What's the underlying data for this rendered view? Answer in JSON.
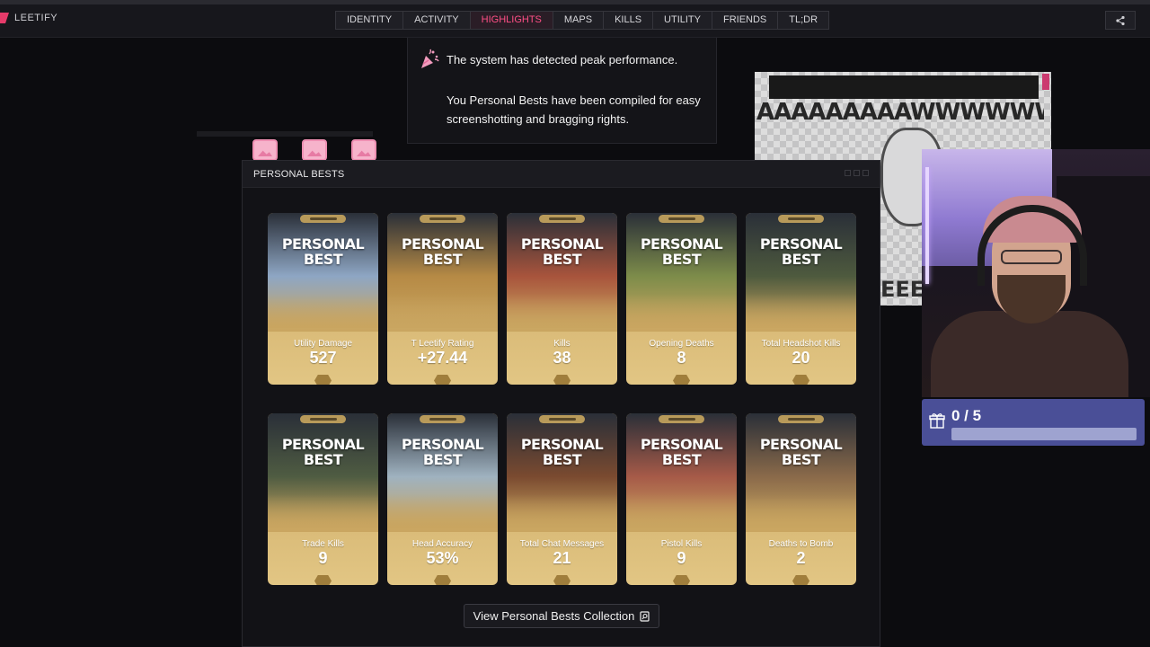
{
  "brand": {
    "name": "LEETIFY",
    "accent": "#e63b6a"
  },
  "nav": {
    "tabs": [
      {
        "label": "IDENTITY",
        "active": false
      },
      {
        "label": "ACTIVITY",
        "active": false
      },
      {
        "label": "HIGHLIGHTS",
        "active": true
      },
      {
        "label": "MAPS",
        "active": false
      },
      {
        "label": "KILLS",
        "active": false
      },
      {
        "label": "UTILITY",
        "active": false
      },
      {
        "label": "FRIENDS",
        "active": false
      },
      {
        "label": "TL;DR",
        "active": false
      }
    ],
    "share_icon": "share-icon"
  },
  "notice": {
    "icon": "party-popper-icon",
    "line1": "The system has detected peak performance.",
    "line2": "You Personal Bests have been compiled for easy screenshotting and bragging rights."
  },
  "overlay": {
    "meme_text": "AAAAAAAAAWWWWWW",
    "meme_bottom": "EEEA",
    "goal_count": "0 / 5",
    "goal_progress": 0
  },
  "panel": {
    "title": "PERSONAL BESTS",
    "card_heading": "PERSONAL\nBEST",
    "cards": [
      {
        "label": "Utility Damage",
        "value": "527",
        "scene": "#8ea6c4"
      },
      {
        "label": "T Leetify Rating",
        "value": "+27.44",
        "scene": "#b68a45"
      },
      {
        "label": "Kills",
        "value": "38",
        "scene": "#a8543c"
      },
      {
        "label": "Opening Deaths",
        "value": "8",
        "scene": "#7d8c4a"
      },
      {
        "label": "Total Headshot Kills",
        "value": "20",
        "scene": "#4e5a3e"
      },
      {
        "label": "Trade Kills",
        "value": "9",
        "scene": "#4f5c42"
      },
      {
        "label": "Head Accuracy",
        "value": "53%",
        "scene": "#9fb2c0"
      },
      {
        "label": "Total Chat Messages",
        "value": "21",
        "scene": "#7a4a30"
      },
      {
        "label": "Pistol Kills",
        "value": "9",
        "scene": "#a65a48"
      },
      {
        "label": "Deaths to Bomb",
        "value": "2",
        "scene": "#8a6a4a"
      }
    ],
    "view_button": "View Personal Bests Collection"
  }
}
